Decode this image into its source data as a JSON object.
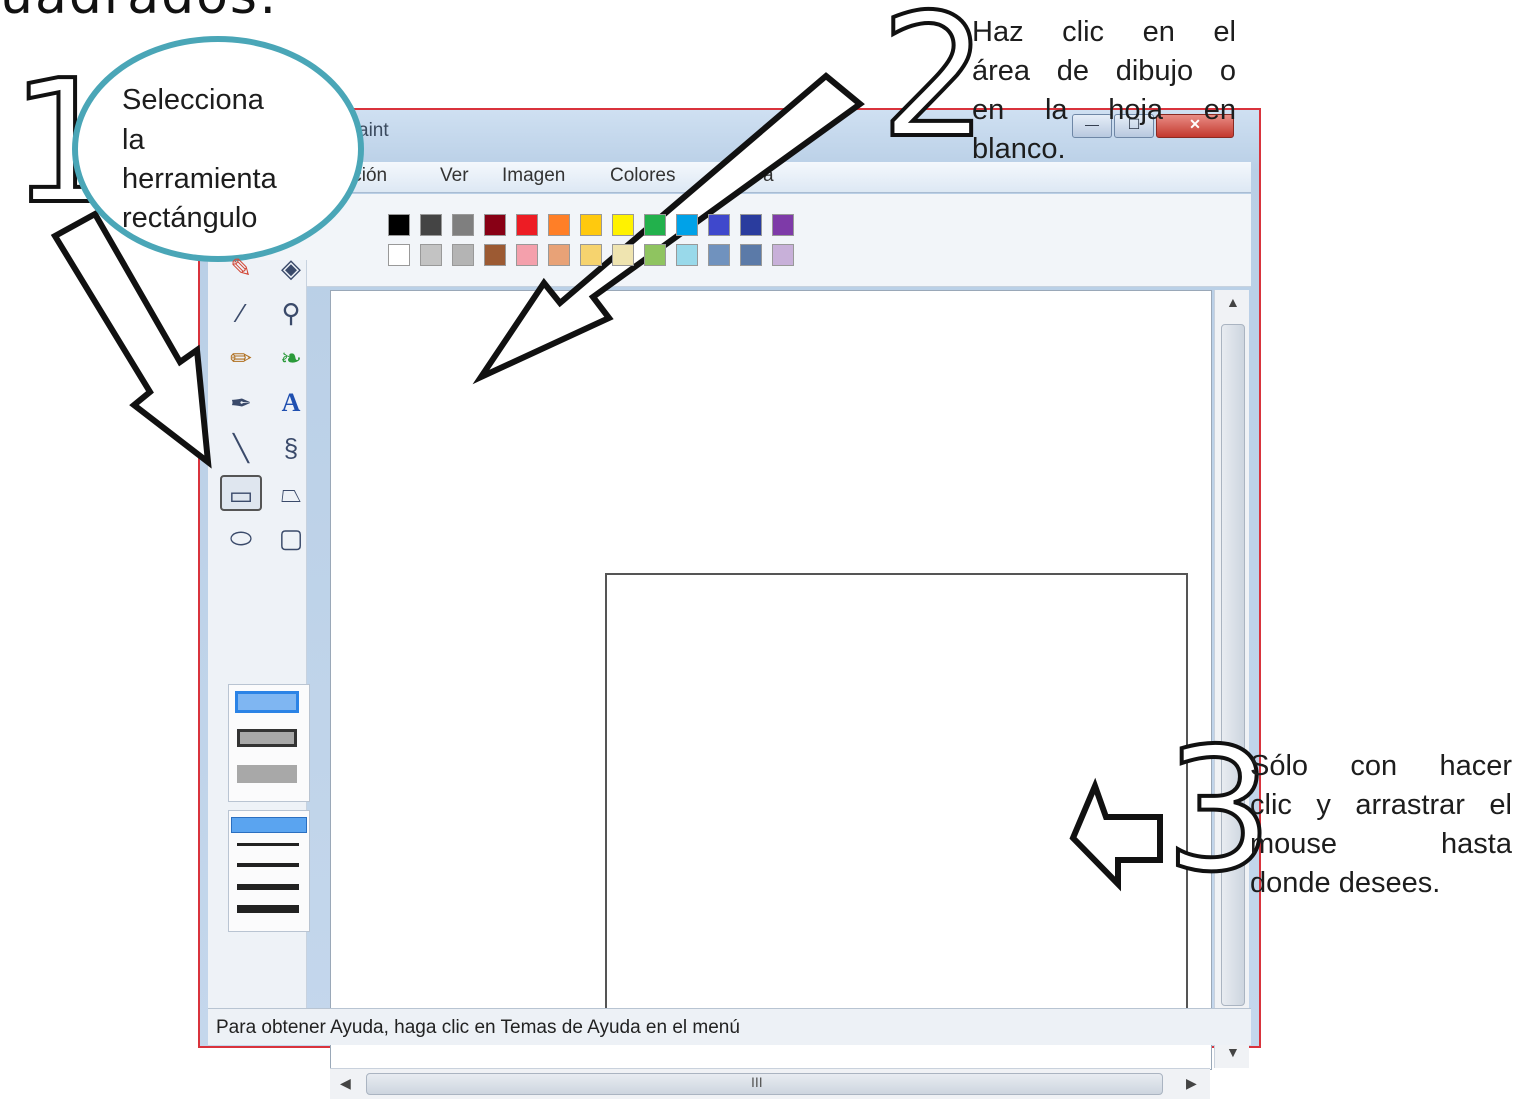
{
  "heading": "uadrados:",
  "window": {
    "title": "aint",
    "menu": [
      "ición",
      "Ver",
      "Imagen",
      "Colores",
      "a"
    ],
    "status": "Para obtener Ayuda, haga clic en Temas de Ayuda en el menú",
    "scroll_thumb_mark": "III"
  },
  "palette": {
    "row1": [
      "#000000",
      "#444444",
      "#7f7f7f",
      "#880015",
      "#ed1c24",
      "#ff7f27",
      "#ffc90e",
      "#fff200",
      "#22b14c",
      "#00a2e8",
      "#3f48cc",
      "#2a3c9e",
      "#7e3aa8"
    ],
    "row2": [
      "#ffffff",
      "#c3c3c3",
      "#b4b4b4",
      "#9c5a33",
      "#f4a0ac",
      "#e8a277",
      "#f6d36e",
      "#efe4b0",
      "#8fc460",
      "#99d9ea",
      "#7092be",
      "#5b7aa8",
      "#c8b0d9"
    ],
    "foreground": "#000000",
    "background": "#ffffff"
  },
  "tools": [
    "eraser-icon",
    "fill-icon",
    "picker-icon",
    "magnifier-icon",
    "pencil-icon",
    "brush-icon",
    "airbrush-icon",
    "text-icon",
    "line-icon",
    "curve-icon",
    "rectangle-icon",
    "polygon-icon",
    "ellipse-icon",
    "rounded-rectangle-icon"
  ],
  "annotations": {
    "step1": {
      "number": "1",
      "bubble_lines": [
        "Selecciona",
        "la",
        "herramienta",
        "rectángulo"
      ]
    },
    "step2": {
      "number": "2",
      "lines": [
        [
          "Haz",
          "clic",
          "en",
          "el"
        ],
        [
          "área",
          "de",
          "dibujo",
          "o"
        ],
        [
          "en",
          "la",
          "hoja",
          "en"
        ],
        [
          "blanco."
        ]
      ]
    },
    "step3": {
      "number": "3",
      "lines": [
        [
          "Sólo",
          "con",
          "hacer"
        ],
        [
          "clic",
          "y",
          "arrastrar",
          "el"
        ],
        [
          "mouse",
          "hasta"
        ],
        [
          "donde desees."
        ]
      ]
    }
  },
  "colors": {
    "window_border": "#d9333c",
    "bubble_border": "#4aa6b7"
  }
}
